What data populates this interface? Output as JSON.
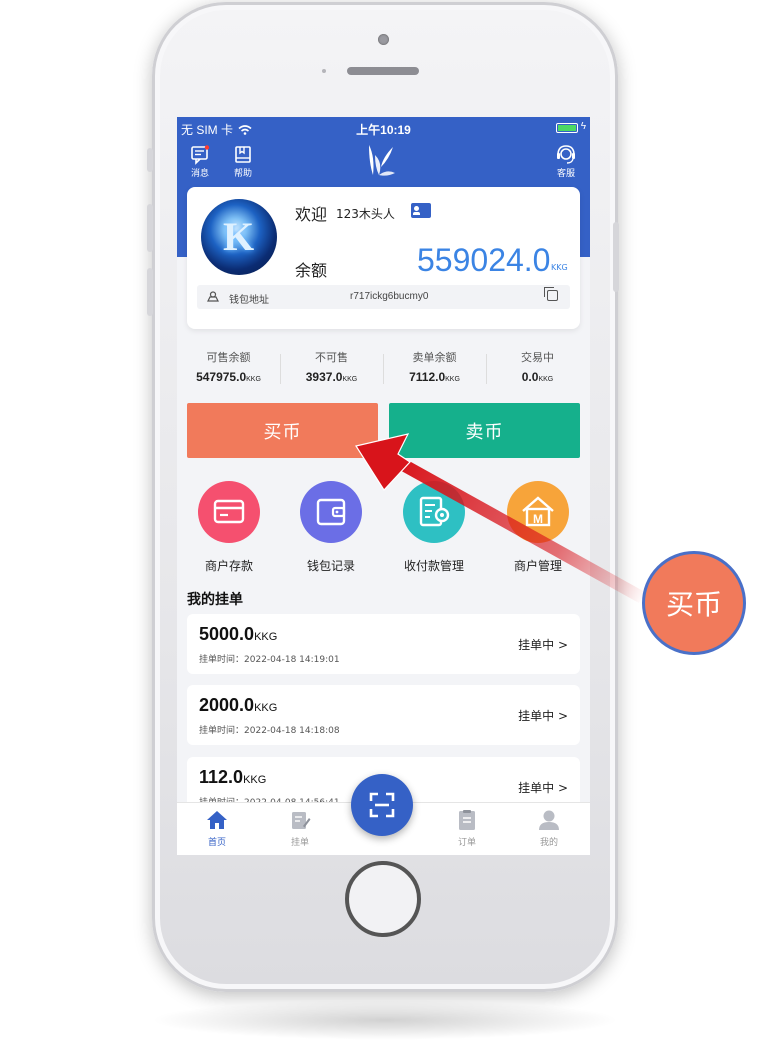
{
  "status_bar": {
    "carrier": "无 SIM 卡",
    "time": "上午10:19"
  },
  "top_nav": {
    "messages_label": "消息",
    "help_label": "帮助",
    "service_label": "客服"
  },
  "profile": {
    "welcome": "欢迎",
    "username": "123木头人",
    "balance_label": "余额",
    "balance_value": "559024.0",
    "balance_unit": "KKG",
    "wallet_label": "钱包地址",
    "wallet_address": "r717ickg6bucmy0"
  },
  "stats": [
    {
      "title": "可售余额",
      "value": "547975.0",
      "unit": "KKG"
    },
    {
      "title": "不可售",
      "value": "3937.0",
      "unit": "KKG"
    },
    {
      "title": "卖单余额",
      "value": "7112.0",
      "unit": "KKG"
    },
    {
      "title": "交易中",
      "value": "0.0",
      "unit": "KKG"
    }
  ],
  "actions": {
    "buy_label": "买币",
    "sell_label": "卖币"
  },
  "quick_actions": [
    {
      "label": "商户存款",
      "icon": "card-icon",
      "color": "#f5506f"
    },
    {
      "label": "钱包记录",
      "icon": "wallet-icon",
      "color": "#6b6ee6"
    },
    {
      "label": "收付款管理",
      "icon": "payment-settings-icon",
      "color": "#2ec0c3"
    },
    {
      "label": "商户管理",
      "icon": "merchant-house-icon",
      "color": "#f7a43a"
    }
  ],
  "orders_title": "我的挂单",
  "orders": [
    {
      "amount": "5000.0",
      "unit": "KKG",
      "time_label": "挂单时间：",
      "time": "2022-04-18 14:19:01",
      "status": "挂单中 >"
    },
    {
      "amount": "2000.0",
      "unit": "KKG",
      "time_label": "挂单时间：",
      "time": "2022-04-18 14:18:08",
      "status": "挂单中 >"
    },
    {
      "amount": "112.0",
      "unit": "KKG",
      "time_label": "挂单时间：",
      "time": "2022-04-08 14:56:41",
      "status": "挂单中 >"
    }
  ],
  "tabbar": {
    "home": "首页",
    "orders_posted": "挂单",
    "orders": "订单",
    "mine": "我的"
  },
  "annotation": {
    "badge_text": "买币"
  },
  "colors": {
    "primary": "#3561c6",
    "buy": "#f17a5b",
    "sell": "#15b08c",
    "arrow": "#d8141b"
  }
}
